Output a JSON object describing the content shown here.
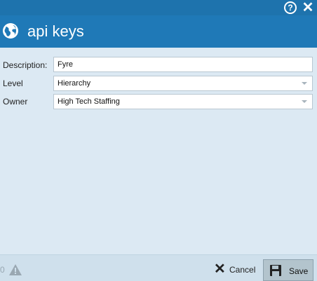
{
  "window": {
    "help_icon": "help-circle-icon",
    "help_glyph": "?",
    "close_icon": "close-icon",
    "close_glyph": "✕"
  },
  "header": {
    "icon": "globe-icon",
    "title": "api keys"
  },
  "form": {
    "description": {
      "label": "Description:",
      "value": "Fyre"
    },
    "level": {
      "label": "Level",
      "value": "Hierarchy"
    },
    "owner": {
      "label": "Owner",
      "value": "High Tech Staffing"
    }
  },
  "footer": {
    "warning_count": "0",
    "warning_icon": "warning-triangle-icon",
    "cancel_label": "Cancel",
    "cancel_icon": "close-icon",
    "cancel_glyph": "✕",
    "save_label": "Save",
    "save_icon": "floppy-disk-icon"
  },
  "colors": {
    "header": "#1f79b7",
    "topbar": "#1e73ad",
    "body": "#dce9f3",
    "footer": "#cfe0ec"
  }
}
